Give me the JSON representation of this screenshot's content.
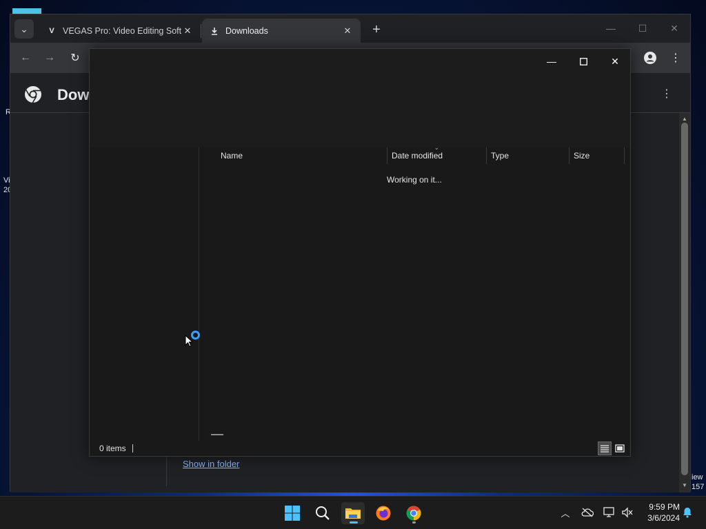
{
  "desktop": {
    "peek_left_1": "R",
    "peek_left_2": "Vi",
    "peek_left_3": "20",
    "peek_right_1": "iew",
    "peek_right_2": "157"
  },
  "browser": {
    "tabs": [
      {
        "label": "VEGAS Pro: Video Editing Softw",
        "favicon": "V",
        "active": false
      },
      {
        "label": "Downloads",
        "favicon": "download-icon",
        "active": true
      }
    ],
    "page_title": "Dow",
    "download_link": "Show in folder"
  },
  "dialog": {
    "columns": [
      "Name",
      "Date modified",
      "Type",
      "Size"
    ],
    "loading_text": "Working on it...",
    "status_count": "0 items"
  },
  "taskbar": {
    "time": "9:59 PM",
    "date": "3/6/2024"
  },
  "colors": {
    "accent": "#4cc2ff",
    "link": "#8ab4f8",
    "busy_ring": "#3aa0ff"
  }
}
